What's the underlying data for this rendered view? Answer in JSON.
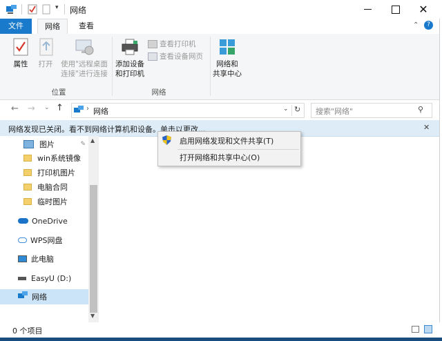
{
  "window": {
    "title": "网络",
    "minimize_icon": "minimize-icon",
    "maximize_icon": "maximize-icon",
    "close_icon": "close-icon"
  },
  "ribbon_tabs": {
    "file": "文件",
    "network": "网络",
    "view": "查看"
  },
  "ribbon": {
    "properties": "属性",
    "open": "打开",
    "remote_line1": "使用\"远程桌面",
    "remote_line2": "连接\"进行连接",
    "group_location": "位置",
    "add_devices_line1": "添加设备",
    "add_devices_line2": "和打印机",
    "view_printers": "查看打印机",
    "view_device_page": "查看设备网页",
    "network_center_line1": "网络和",
    "network_center_line2": "共享中心",
    "group_network": "网络"
  },
  "address": {
    "path": "网络",
    "search_placeholder": "搜索\"网络\""
  },
  "infobar": {
    "message": "网络发现已关闭。看不到网络计算机和设备。单击以更改..."
  },
  "context_menu": {
    "item1": "启用网络发现和文件共享(T)",
    "item2": "打开网络和共享中心(O)"
  },
  "nav_pane": {
    "items": [
      {
        "label": "图片"
      },
      {
        "label": "win系统镜像"
      },
      {
        "label": "打印机图片"
      },
      {
        "label": "电脑合同"
      },
      {
        "label": "临时图片"
      },
      {
        "label": "OneDrive"
      },
      {
        "label": "WPS网盘"
      },
      {
        "label": "此电脑"
      },
      {
        "label": "EasyU (D:)"
      },
      {
        "label": "网络"
      }
    ]
  },
  "status": {
    "count": "0 个项目"
  },
  "colors": {
    "accent": "#1979ca",
    "infobar_bg": "#ddecf7",
    "selected_bg": "#cce4f7"
  }
}
